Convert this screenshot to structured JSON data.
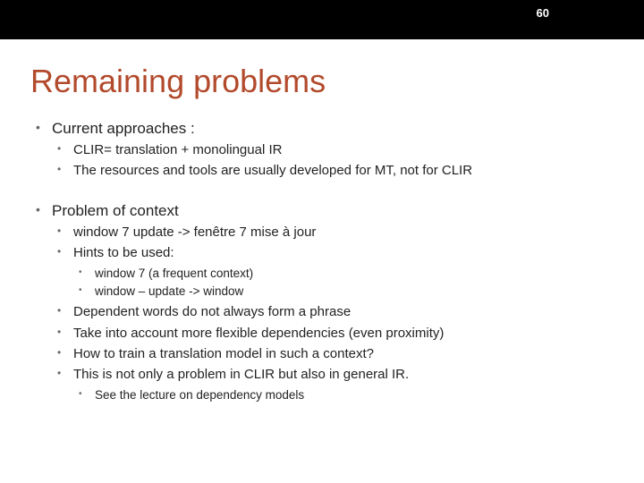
{
  "page_number": "60",
  "title": "Remaining problems",
  "bullets": {
    "section1": {
      "heading": "Current approaches :",
      "items": [
        "CLIR= translation + monolingual IR",
        "The resources and tools are usually developed for MT, not for CLIR"
      ]
    },
    "section2": {
      "heading": "Problem of context",
      "items_a": [
        "window 7 update -> fenêtre 7 mise à jour",
        "Hints to be used:"
      ],
      "sub_a": [
        "window 7 (a frequent context)",
        "window – update -> window"
      ],
      "items_b": [
        "Dependent words do not always form a phrase",
        "Take into account more flexible dependencies (even proximity)",
        "How to train a translation model in such a context?",
        "This is not only a problem in CLIR but also in general IR."
      ],
      "sub_b": [
        "See the lecture on dependency models"
      ]
    }
  }
}
